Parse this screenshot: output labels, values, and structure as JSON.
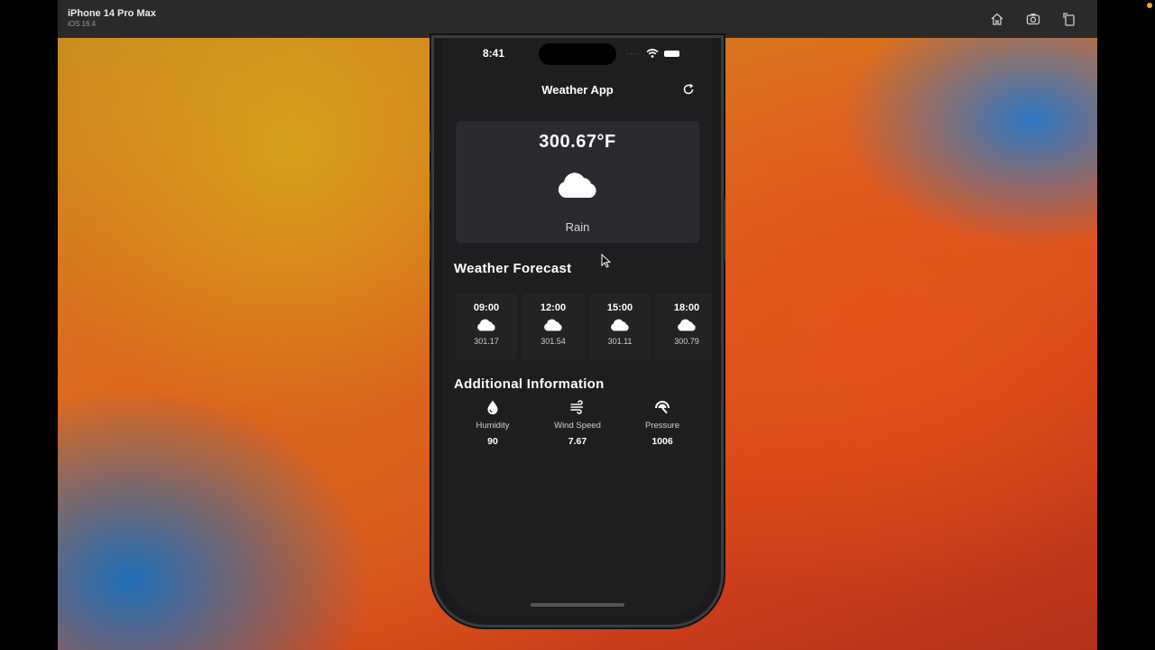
{
  "simulator": {
    "device_name": "iPhone 14 Pro Max",
    "os_version": "iOS 16.4",
    "tools": [
      "home-icon",
      "screenshot-icon",
      "rotate-icon"
    ]
  },
  "status_bar": {
    "time": "8:41",
    "dots": "····"
  },
  "app": {
    "title": "Weather App",
    "refresh_icon": "refresh-icon"
  },
  "current": {
    "temperature": "300.67°F",
    "condition": "Rain",
    "icon": "cloud-icon"
  },
  "forecast": {
    "title": "Weather Forecast",
    "items": [
      {
        "time": "09:00",
        "temp": "301.17",
        "icon": "cloud-icon"
      },
      {
        "time": "12:00",
        "temp": "301.54",
        "icon": "cloud-icon"
      },
      {
        "time": "15:00",
        "temp": "301.11",
        "icon": "cloud-icon"
      },
      {
        "time": "18:00",
        "temp": "300.79",
        "icon": "cloud-icon"
      }
    ]
  },
  "additional": {
    "title": "Additional Information",
    "items": [
      {
        "label": "Humidity",
        "value": "90",
        "icon": "humidity-drop-icon"
      },
      {
        "label": "Wind Speed",
        "value": "7.67",
        "icon": "wind-icon"
      },
      {
        "label": "Pressure",
        "value": "1006",
        "icon": "pressure-gauge-icon"
      }
    ]
  },
  "colors": {
    "screen_bg": "#1e1e20",
    "card_bg": "#2a2a2f",
    "text": "#ffffff"
  }
}
